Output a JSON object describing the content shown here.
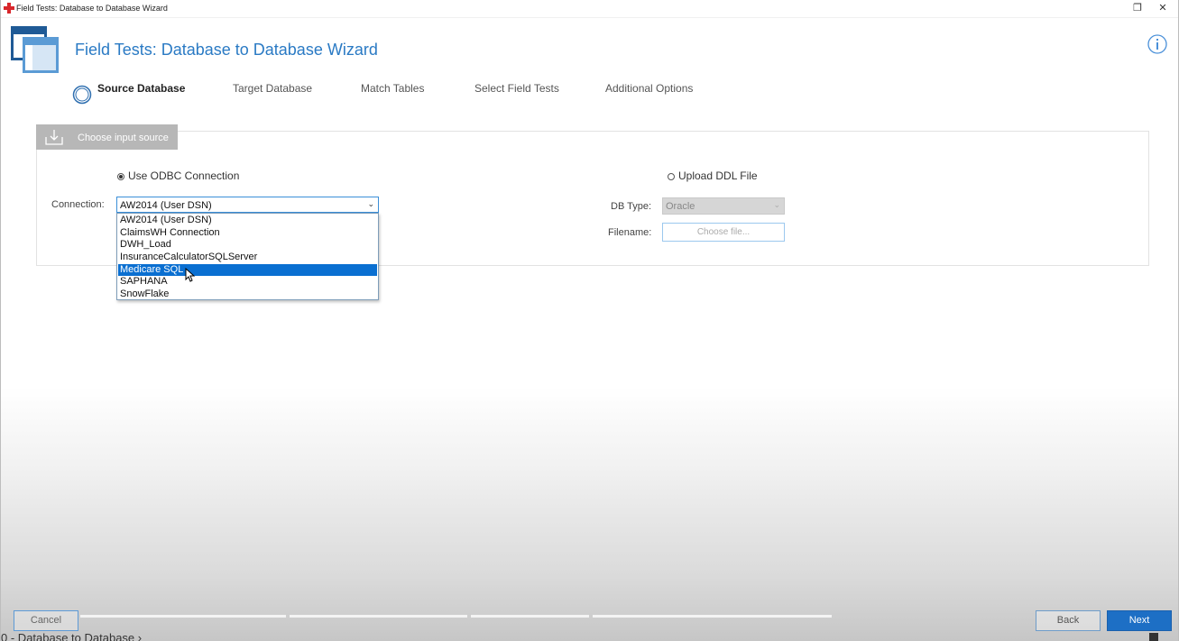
{
  "window": {
    "title": "Field Tests: Database to Database Wizard",
    "restore_glyph": "❐",
    "close_glyph": "✕",
    "accent_color": "#2a7ac4"
  },
  "header": {
    "title": "Field Tests: Database to Database Wizard",
    "info_icon": "info-icon"
  },
  "steps": [
    {
      "label": "Source Database",
      "active": true
    },
    {
      "label": "Target Database",
      "active": false
    },
    {
      "label": "Match Tables",
      "active": false
    },
    {
      "label": "Select Field Tests",
      "active": false
    },
    {
      "label": "Additional Options",
      "active": false
    }
  ],
  "input_source": {
    "tab_label": "Choose input source",
    "odbc_radio": "Use ODBC Connection",
    "ddl_radio": "Upload DDL File",
    "odbc_selected": true,
    "connection_label": "Connection:",
    "connection_value": "AW2014 (User DSN)",
    "connection_options": [
      "AW2014 (User DSN)",
      "ClaimsWH Connection",
      "DWH_Load",
      "InsuranceCalculatorSQLServer",
      "Medicare SQL",
      "SAPHANA",
      "SnowFlake"
    ],
    "highlighted_option": "Medicare SQL",
    "dbtype_label": "DB Type:",
    "dbtype_value": "Oracle",
    "filename_label": "Filename:",
    "file_button": "Choose file..."
  },
  "footer": {
    "cancel": "Cancel",
    "back": "Back",
    "next": "Next",
    "next_color": "#1d6fc5"
  },
  "breadcrumb": {
    "prefix": "0",
    "text": "- Database to Database",
    "chevron": "›"
  }
}
